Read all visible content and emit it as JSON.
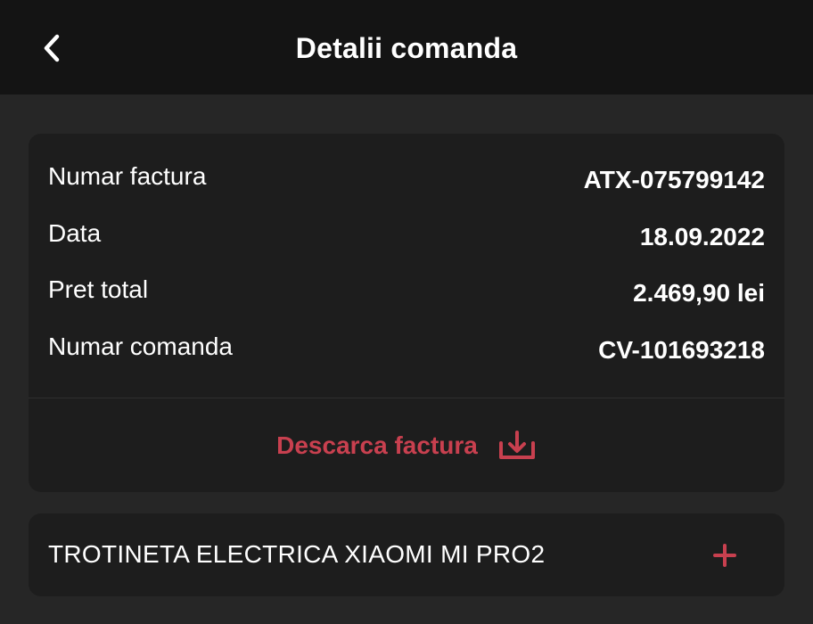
{
  "header": {
    "title": "Detalii comanda",
    "back_icon": "chevron-left-icon"
  },
  "invoice": {
    "rows": [
      {
        "label": "Numar factura",
        "value": "ATX-075799142"
      },
      {
        "label": "Data",
        "value": "18.09.2022"
      },
      {
        "label": "Pret total",
        "value": "2.469,90 lei"
      },
      {
        "label": "Numar comanda",
        "value": "CV-101693218"
      }
    ],
    "download_label": "Descarca factura",
    "download_icon": "download-icon"
  },
  "product": {
    "name": "TROTINETA ELECTRICA XIAOMI MI PRO2",
    "expand_icon": "plus-icon"
  },
  "colors": {
    "accent": "#c8404f",
    "header_bg": "#141414",
    "page_bg": "#262626",
    "card_bg": "#1d1d1d"
  }
}
